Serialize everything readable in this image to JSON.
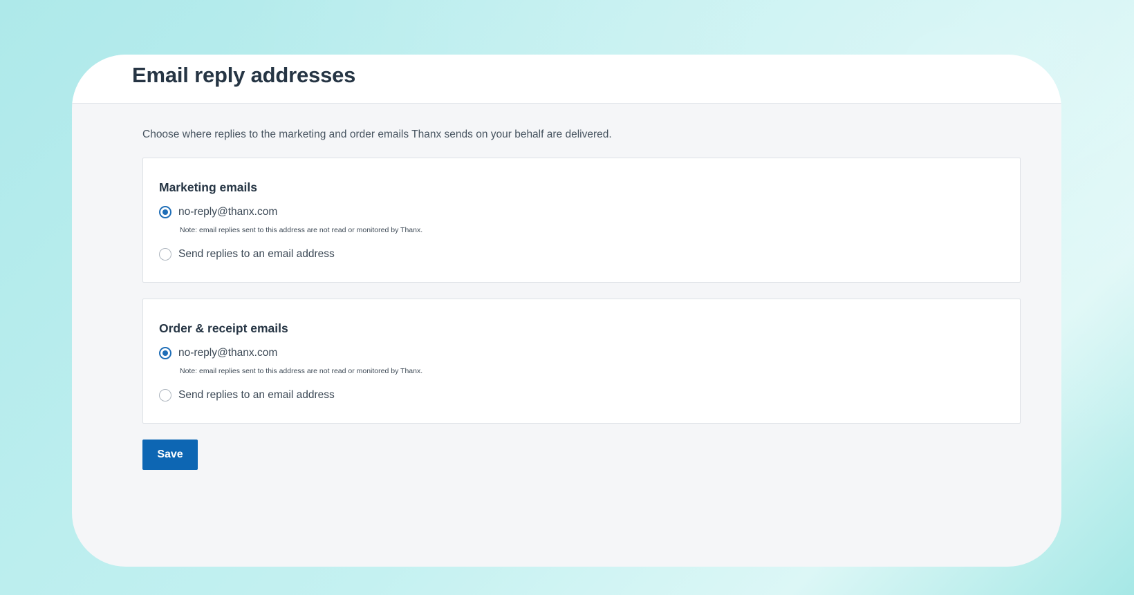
{
  "page": {
    "title": "Email reply addresses",
    "intro": "Choose where replies to the marketing and order emails Thanx sends on your behalf are delivered."
  },
  "sections": [
    {
      "title": "Marketing emails",
      "options": [
        {
          "label": "no-reply@thanx.com",
          "selected": true
        },
        {
          "label": "Send replies to an email address",
          "selected": false
        }
      ],
      "note": "Note: email replies sent to this address are not read or monitored by Thanx."
    },
    {
      "title": "Order & receipt emails",
      "options": [
        {
          "label": "no-reply@thanx.com",
          "selected": true
        },
        {
          "label": "Send replies to an email address",
          "selected": false
        }
      ],
      "note": "Note: email replies sent to this address are not read or monitored by Thanx."
    }
  ],
  "actions": {
    "save_label": "Save"
  },
  "colors": {
    "accent": "#0d66b3",
    "title": "#263544",
    "panel_bg": "#ffffff",
    "card_bg": "#f5f6f8"
  }
}
